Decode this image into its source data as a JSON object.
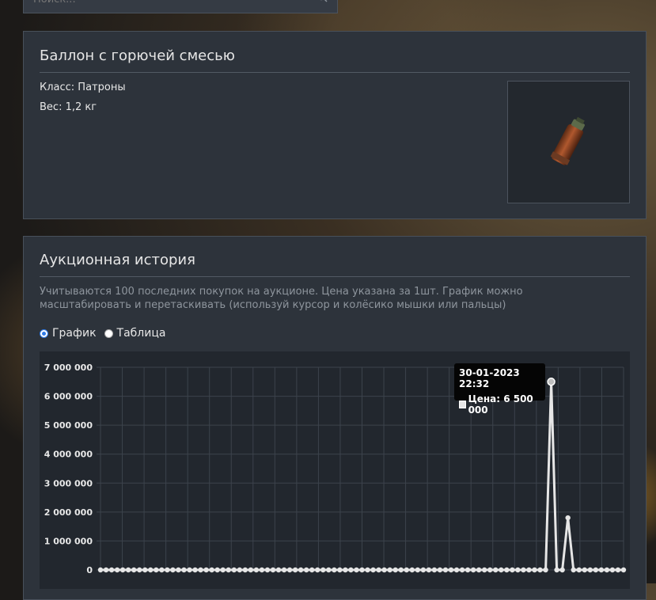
{
  "search": {
    "placeholder": "Поиск..."
  },
  "item": {
    "title": "Баллон с горючей смесью",
    "class_label": "Класс: Патроны",
    "weight_label": "Вес: 1,2 кг",
    "image_icon": "fuel-canister-icon"
  },
  "history": {
    "title": "Аукционная история",
    "note": "Учитываются 100 последних покупок на аукционе. Цена указана за 1шт. График можно масштабировать и перетаскивать (используй курсор и колёсико мышки или пальцы)",
    "view_chart": "График",
    "view_table": "Таблица",
    "selected_view": "График"
  },
  "tooltip": {
    "date": "30-01-2023 22:32",
    "price": "Цена: 6 500 000"
  },
  "colors": {
    "panel": "#2d333b",
    "line": "#e6e6e6",
    "accent": "#2f7be8"
  },
  "chart_data": {
    "type": "line",
    "title": "",
    "xlabel": "",
    "ylabel": "",
    "ylim": [
      0,
      7000000
    ],
    "yticks": [
      0,
      1000000,
      2000000,
      3000000,
      4000000,
      5000000,
      6000000,
      7000000
    ],
    "ytick_labels": [
      "0",
      "1 000 000",
      "2 000 000",
      "3 000 000",
      "4 000 000",
      "5 000 000",
      "6 000 000",
      "7 000 000"
    ],
    "grid": true,
    "legend": "none",
    "series": [
      {
        "values": [
          0,
          0,
          0,
          0,
          0,
          0,
          0,
          0,
          0,
          0,
          0,
          0,
          0,
          0,
          0,
          0,
          0,
          0,
          0,
          0,
          0,
          0,
          0,
          0,
          0,
          0,
          0,
          0,
          0,
          0,
          0,
          0,
          0,
          0,
          0,
          0,
          0,
          0,
          0,
          0,
          0,
          0,
          0,
          0,
          0,
          0,
          0,
          0,
          0,
          0,
          0,
          0,
          0,
          0,
          0,
          0,
          0,
          0,
          0,
          0,
          0,
          0,
          0,
          0,
          0,
          0,
          0,
          0,
          0,
          0,
          0,
          0,
          0,
          0,
          0,
          0,
          0,
          0,
          0,
          0,
          0,
          6500000,
          0,
          0,
          1800000,
          0,
          0,
          0,
          0,
          0,
          0,
          0,
          0,
          0,
          0
        ]
      }
    ]
  }
}
